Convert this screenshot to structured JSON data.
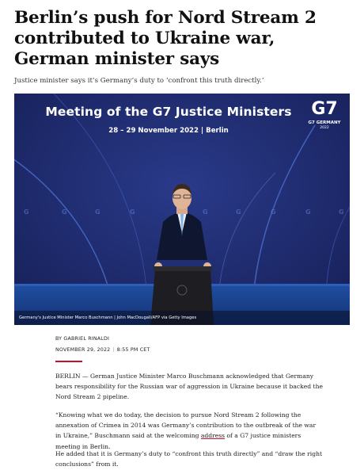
{
  "article": {
    "headline": "Berlin’s push for Nord Stream 2 contributed to Ukraine war, German minister says",
    "subhead": "Justice minister says it’s Germany’s duty to ‘confront this truth directly.’",
    "byline": "BY GABRIEL RINALDI",
    "date": "NOVEMBER 29, 2022",
    "time": "8:55 PM CET",
    "paragraphs": {
      "p1": "BERLIN — German Justice Minister Marco Buschmann acknowledged that Germany bears responsibility for the Russian war of aggression in Ukraine because it backed the Nord Stream 2 pipeline.",
      "p2_before": "“Knowing what we do today, the decision to pursue Nord Stream 2 following the annexation of Crimea in 2014 was Germany’s contribution to the outbreak of the war in Ukraine,” Buschmann said at the welcoming ",
      "p2_link": "address",
      "p2_after": " of a G7 justice ministers meeting in Berlin.",
      "p3": "He added that it is Germany’s duty to “confront this truth directly” and “draw the right conclusions” from it."
    }
  },
  "photo": {
    "banner_title": "Meeting of the G7 Justice Ministers",
    "banner_sub": "28 – 29 November 2022  |  Berlin",
    "logo_mark": "G7",
    "logo_name": "G7 GERMANY",
    "logo_year": "2022",
    "caption": "Germany's Justice Minister Marco Buschmann | John MacDougall/AFP via Getty Images"
  },
  "colors": {
    "accent_red": "#c8102e",
    "backdrop_blue": "#1d2a68"
  }
}
